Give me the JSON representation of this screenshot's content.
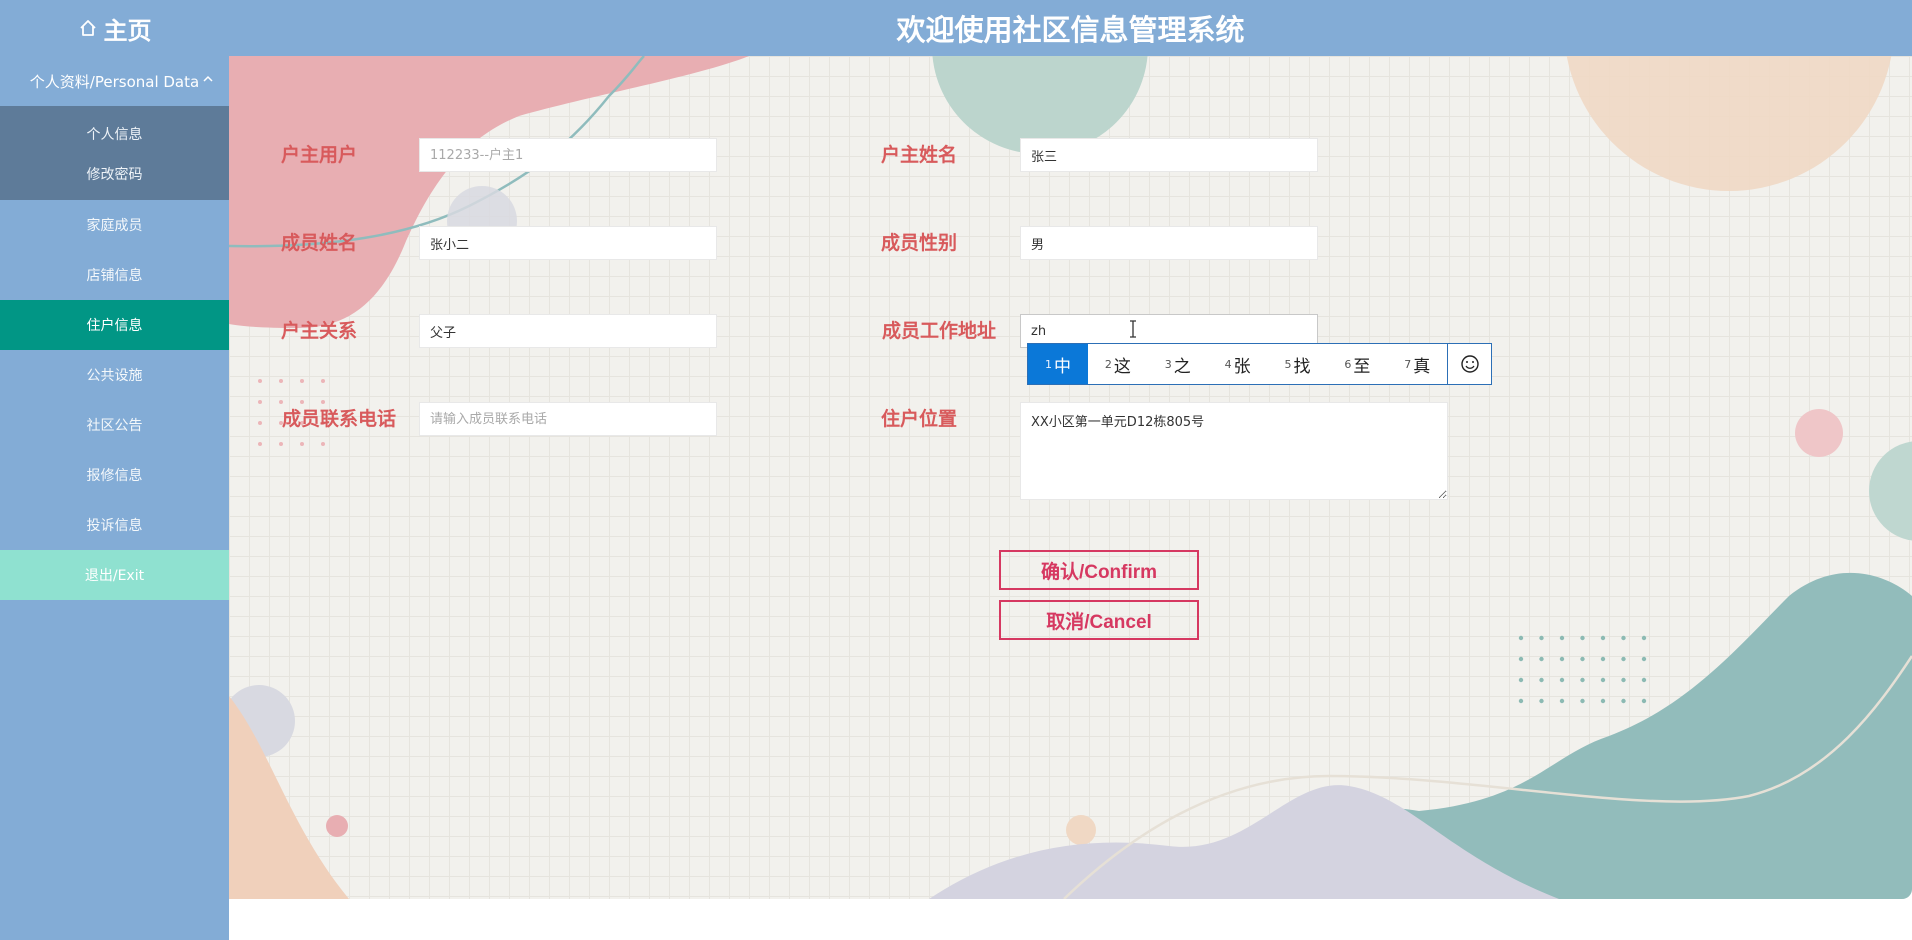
{
  "header": {
    "home_label": "主页",
    "app_title": "欢迎使用社区信息管理系统"
  },
  "sidebar": {
    "group_label": "个人资料/Personal Data",
    "sub_items": [
      {
        "label": "个人信息"
      },
      {
        "label": "修改密码"
      }
    ],
    "items": [
      {
        "label": "家庭成员"
      },
      {
        "label": "店铺信息"
      },
      {
        "label": "住户信息",
        "active": true
      },
      {
        "label": "公共设施"
      },
      {
        "label": "社区公告"
      },
      {
        "label": "报修信息"
      },
      {
        "label": "投诉信息"
      },
      {
        "label": "退出/Exit"
      }
    ]
  },
  "form": {
    "owner_user": {
      "label": "户主用户",
      "value": "",
      "placeholder": "112233--户主1"
    },
    "owner_name": {
      "label": "户主姓名",
      "value": "张三"
    },
    "member_name": {
      "label": "成员姓名",
      "value": "张小二"
    },
    "member_gender": {
      "label": "成员性别",
      "value": "男"
    },
    "relation": {
      "label": "户主关系",
      "value": "父子"
    },
    "work_address": {
      "label": "成员工作地址",
      "value": "zh"
    },
    "phone": {
      "label": "成员联系电话",
      "value": "",
      "placeholder": "请输入成员联系电话"
    },
    "location": {
      "label": "住户位置",
      "value": "XX小区第一单元D12栋805号"
    }
  },
  "buttons": {
    "confirm": "确认/Confirm",
    "cancel": "取消/Cancel"
  },
  "ime": {
    "candidates": [
      {
        "num": "1",
        "text": "中"
      },
      {
        "num": "2",
        "text": "这"
      },
      {
        "num": "3",
        "text": "之"
      },
      {
        "num": "4",
        "text": "张"
      },
      {
        "num": "5",
        "text": "找"
      },
      {
        "num": "6",
        "text": "至"
      },
      {
        "num": "7",
        "text": "真"
      }
    ]
  },
  "colors": {
    "header": "#83acd6",
    "active": "#019685",
    "label": "#d85a5c",
    "button": "#d63861",
    "exit": "#8fe1d0"
  }
}
